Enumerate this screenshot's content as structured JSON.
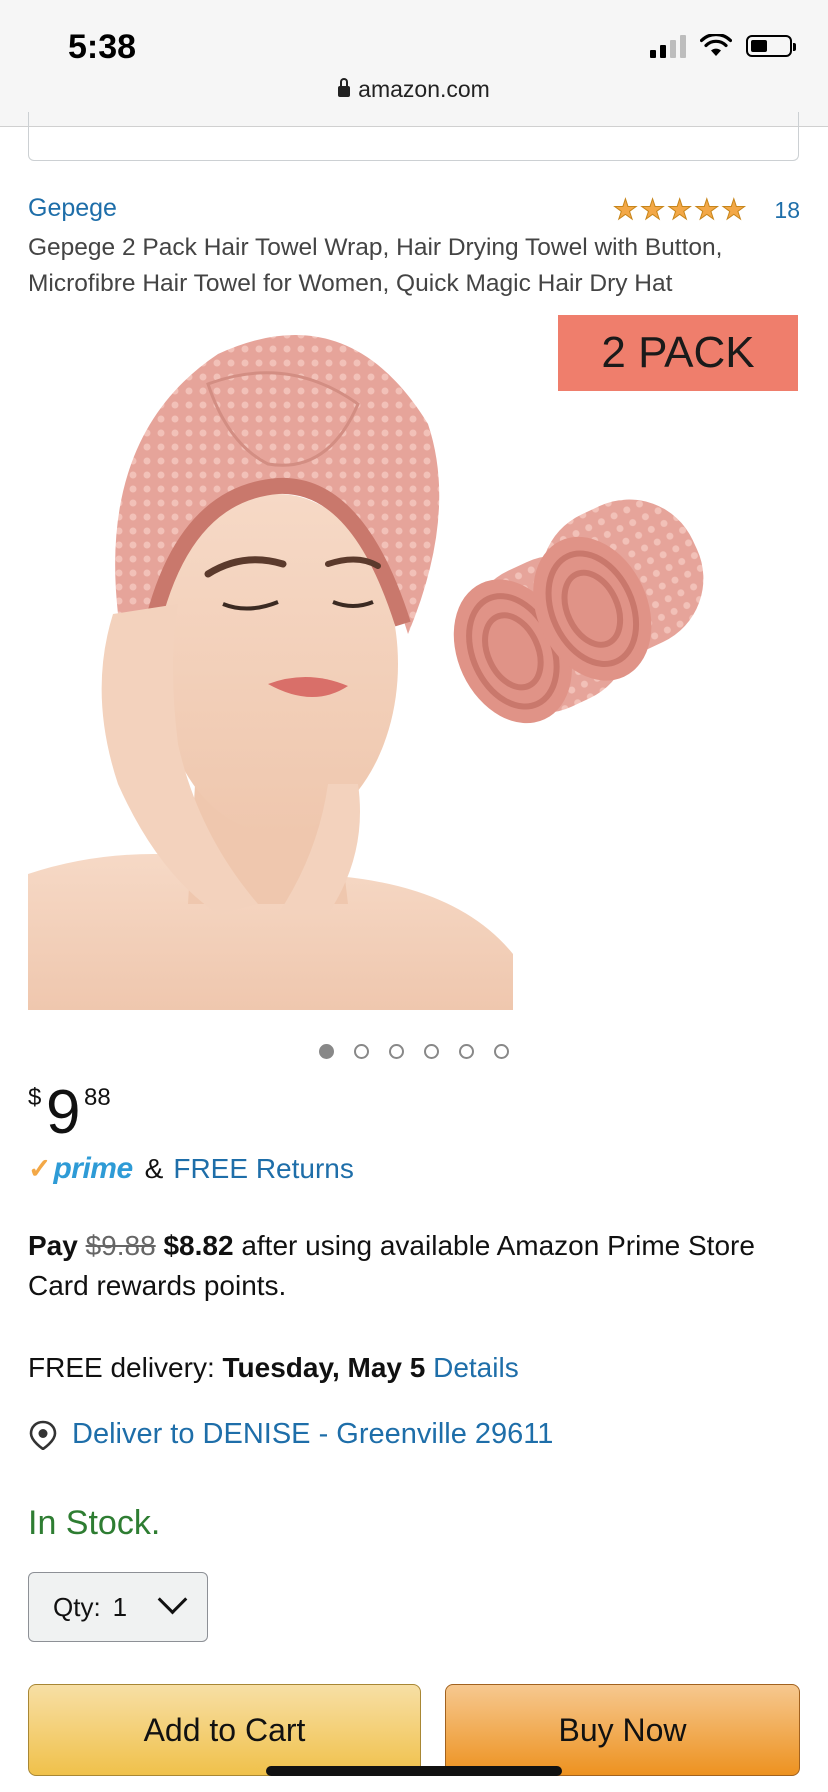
{
  "status_bar": {
    "time": "5:38",
    "url": "amazon.com"
  },
  "product": {
    "brand": "Gepege",
    "rating_count": "18",
    "title": "Gepege 2 Pack Hair Towel Wrap, Hair Drying Towel with Button, Microfibre Hair Towel for Women, Quick Magic Hair Dry Hat",
    "image_badge": "2 PACK",
    "image_count": 6,
    "active_image_index": 0
  },
  "price": {
    "symbol": "$",
    "whole": "9",
    "fraction": "88"
  },
  "prime": {
    "word": "prime",
    "amp": "&",
    "free_returns": "FREE Returns"
  },
  "pay_offer": {
    "pay": "Pay",
    "original": "$9.88",
    "discounted": "$8.82",
    "rest": "after using available Amazon Prime Store Card rewards points."
  },
  "delivery": {
    "label": "FREE delivery:",
    "date": "Tuesday, May 5",
    "details_link": "Details"
  },
  "deliver_to": "Deliver to DENISE - Greenville 29611",
  "stock_status": "In Stock.",
  "quantity": {
    "label": "Qty:",
    "value": "1"
  },
  "buttons": {
    "add_to_cart": "Add to Cart",
    "buy_now": "Buy Now"
  },
  "colors": {
    "link": "#1e6ea9",
    "in_stock": "#2e7d32",
    "prime_blue": "#2e9bd6",
    "star": "#f3a847",
    "badge": "#ef7e6c"
  }
}
